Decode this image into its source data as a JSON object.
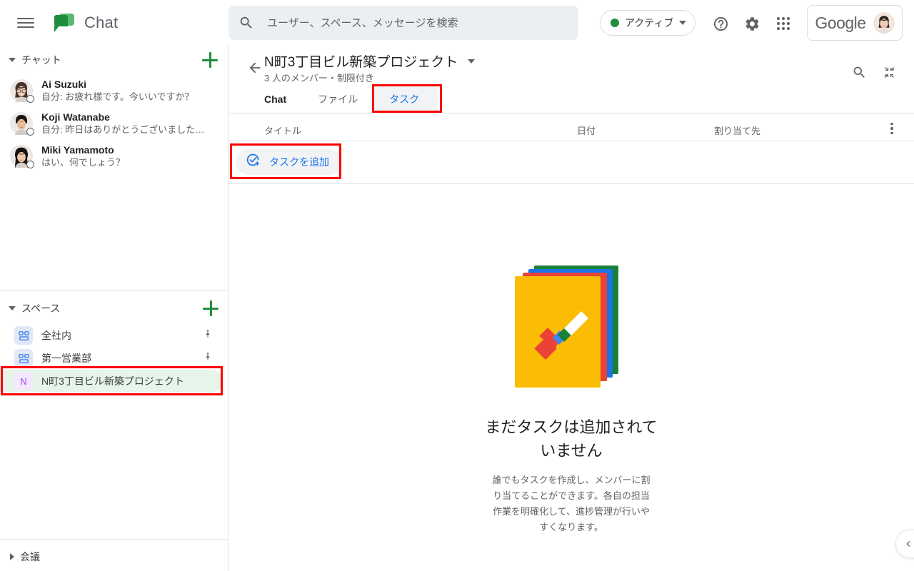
{
  "app": {
    "brand_title": "Chat",
    "menu_icon": "hamburger-icon",
    "logo_icon": "google-chat-logo"
  },
  "search": {
    "placeholder": "ユーザー、スペース、メッセージを検索",
    "value": "",
    "icon": "search-icon"
  },
  "topbar": {
    "status_label": "アクティブ",
    "status_color": "#1e8e3e",
    "help_icon": "help-icon",
    "settings_icon": "gear-icon",
    "apps_icon": "apps-grid-icon",
    "account_word": "Google",
    "avatar_name": "account-avatar"
  },
  "sidebar": {
    "chat_section": {
      "title": "チャット",
      "expanded": true,
      "add_label": "+",
      "items": [
        {
          "name": "Ai Suzuki",
          "snippet": "自分: お疲れ様です。今いいですか？"
        },
        {
          "name": "Koji Watanabe",
          "snippet": "自分: 昨日はありがとうございました…"
        },
        {
          "name": "Miki Yamamoto",
          "snippet": "はい、何でしょう？"
        }
      ]
    },
    "spaces_section": {
      "title": "スペース",
      "expanded": true,
      "add_label": "+",
      "items": [
        {
          "label": "全社内",
          "icon": "group-space-icon",
          "pinned": true,
          "selected": false,
          "avatar_letter": ""
        },
        {
          "label": "第一営業部",
          "icon": "group-space-icon",
          "pinned": true,
          "selected": false,
          "avatar_letter": ""
        },
        {
          "label": "N町3丁目ビル新築プロジェクト",
          "icon": "letter-space-icon",
          "pinned": false,
          "selected": true,
          "avatar_letter": "N"
        }
      ]
    },
    "meet_section": {
      "title": "会議",
      "expanded": false
    }
  },
  "main": {
    "back_icon": "back-arrow-icon",
    "room_title": "N町3丁目ビル新築プロジェクト",
    "room_subtitle": "3 人のメンバー・制限付き",
    "dropdown_icon": "chevron-down-icon",
    "tabs": [
      {
        "label": "Chat",
        "active": false
      },
      {
        "label": "ファイル",
        "active": false
      },
      {
        "label": "タスク",
        "active": true
      }
    ],
    "header_actions": [
      {
        "icon": "search-icon"
      },
      {
        "icon": "collapse-icon"
      }
    ],
    "table": {
      "columns": [
        "タイトル",
        "日付",
        "割り当て先"
      ],
      "overflow_icon": "more-vert-icon",
      "rows": []
    },
    "add_task": {
      "label": "タスクを追加",
      "icon": "check-plus-icon",
      "color": "#1a73e8"
    },
    "empty_state": {
      "illustration": "task-cards-checkmark-illustration",
      "title": "まだタスクは追加されていません",
      "body": "誰でもタスクを作成し、メンバーに割り当てることができます。各自の担当作業を明確化して、進捗管理が行いやすくなります。"
    },
    "collapse_pill_icon": "chevron-left-icon"
  },
  "annotations": {
    "color": "#ff0000",
    "boxes": [
      "tasks-tab",
      "add-task-button",
      "selected-space-row"
    ]
  }
}
